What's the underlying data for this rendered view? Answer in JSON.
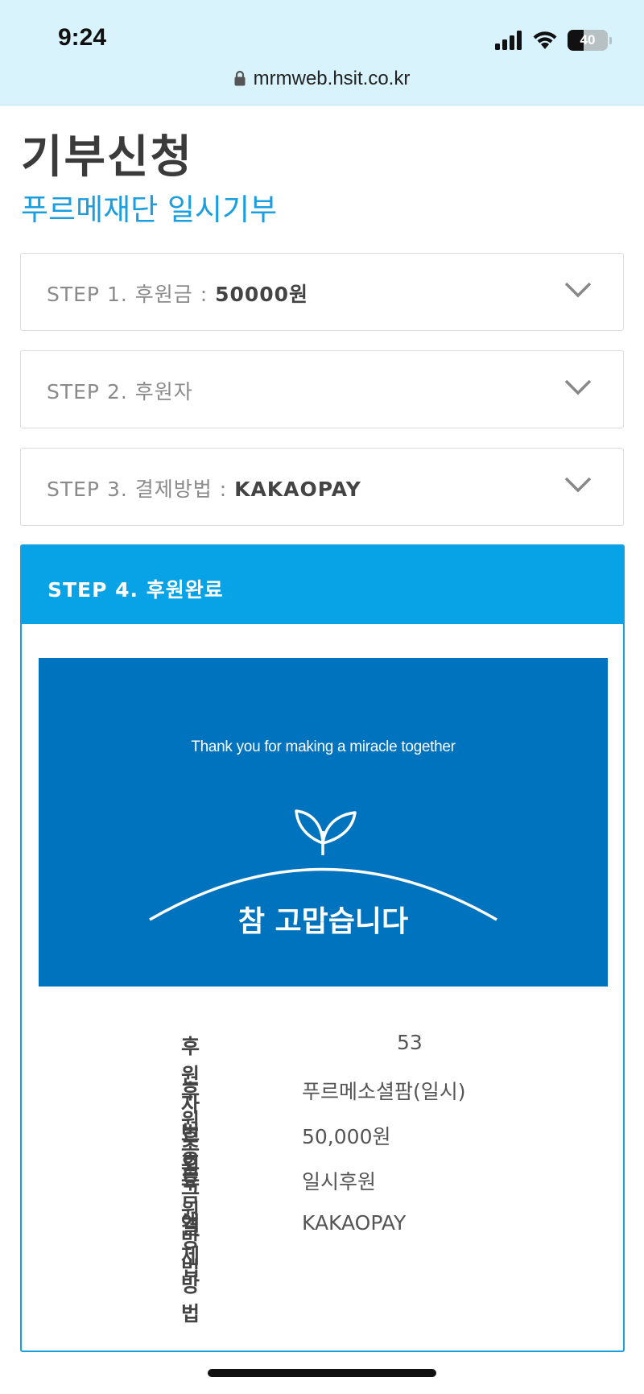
{
  "status_bar": {
    "time": "9:24",
    "battery": "40",
    "battery_level": 0.4
  },
  "browser": {
    "url": "mrmweb.hsit.co.kr"
  },
  "page": {
    "title": "기부신청",
    "subtitle": "푸르메재단 일시기부"
  },
  "steps": [
    {
      "label": "STEP 1. 후원금 : ",
      "value": "50000원"
    },
    {
      "label": "STEP 2. 후원자",
      "value": ""
    },
    {
      "label": "STEP 3. 결제방법 : ",
      "value": "KAKAOPAY"
    }
  ],
  "step4": {
    "label": "STEP 4. 후원완료",
    "banner_message": "Thank you for making a miracle together",
    "banner_thanks": "참 고맙습니다",
    "details": [
      {
        "key": "후원자번호",
        "value": "53"
      },
      {
        "key": "후원종류",
        "value": "푸르메소셜팜(일시)"
      },
      {
        "key": "후원금액",
        "value": "50,000원"
      },
      {
        "key": "후원방법",
        "value": "일시후원"
      },
      {
        "key": "결제방법",
        "value": "KAKAOPAY"
      }
    ]
  },
  "colors": {
    "accent": "#1a9ee0",
    "banner": "#0073bf",
    "step4_header": "#08a3e6"
  },
  "icons": [
    "signal-icon",
    "wifi-icon",
    "battery-icon",
    "lock-icon",
    "chevron-down-icon",
    "sprout-icon"
  ]
}
